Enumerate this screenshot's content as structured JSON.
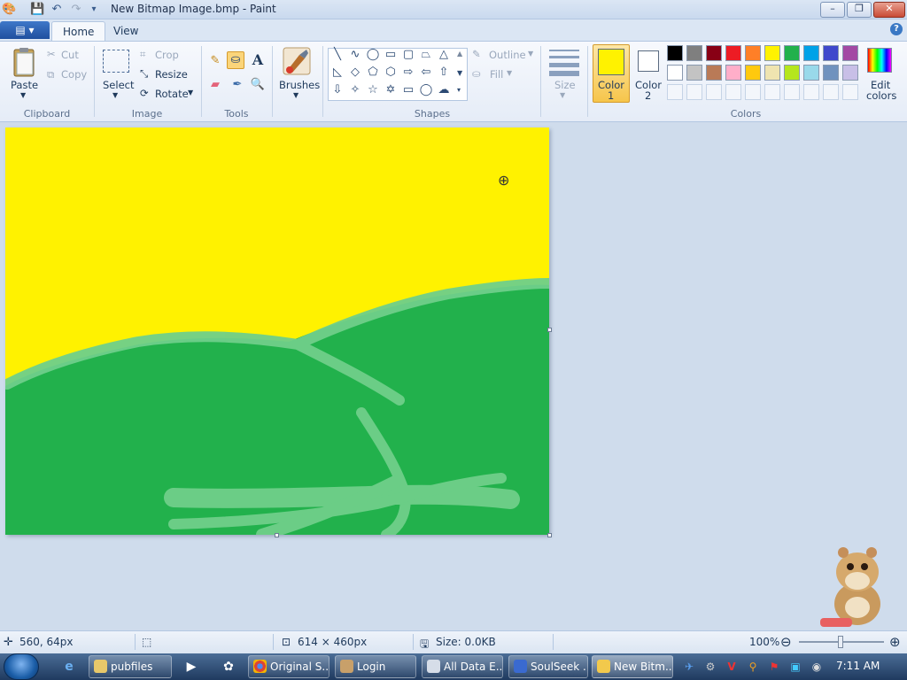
{
  "window": {
    "title": "New Bitmap Image.bmp - Paint",
    "controls": {
      "minimize": "–",
      "maximize": "❐",
      "close": "✕"
    }
  },
  "tabs": {
    "menu": "▤ ▾",
    "home": "Home",
    "view": "View",
    "help": "?"
  },
  "ribbon": {
    "clipboard": {
      "paste": "Paste",
      "cut": "Cut",
      "copy": "Copy",
      "group": "Clipboard"
    },
    "image": {
      "select": "Select",
      "crop": "Crop",
      "resize": "Resize",
      "rotate": "Rotate",
      "group": "Image"
    },
    "tools": {
      "group": "Tools"
    },
    "brushes": {
      "label": "Brushes"
    },
    "shapes": {
      "outline": "Outline",
      "fill": "Fill",
      "group": "Shapes"
    },
    "size": {
      "label": "Size"
    },
    "colors": {
      "color1_label": "Color",
      "color1_num": "1",
      "color2_label": "Color",
      "color2_num": "2",
      "edit_label": "Edit",
      "edit_label2": "colors",
      "group": "Colors",
      "color1_value": "#fff200",
      "color2_value": "#ffffff",
      "palette_row1": [
        "#000000",
        "#7f7f7f",
        "#880015",
        "#ed1c24",
        "#ff7f27",
        "#fff200",
        "#22b14c",
        "#00a2e8",
        "#3f48cc",
        "#a349a4"
      ],
      "palette_row2": [
        "#ffffff",
        "#c3c3c3",
        "#b97a57",
        "#ffaec9",
        "#ffc90e",
        "#efe4b0",
        "#b5e61d",
        "#99d9ea",
        "#7092be",
        "#c8bfe7"
      ]
    }
  },
  "canvas": {
    "sky_color": "#fff200",
    "grass_color": "#22b14c"
  },
  "status": {
    "cursor_pos": "560, 64px",
    "canvas_size": "614 × 460px",
    "file_size": "Size: 0.0KB",
    "zoom": "100%"
  },
  "taskbar": {
    "items": [
      {
        "label": "pubfiles"
      },
      {
        "label": "Original S..."
      },
      {
        "label": "Login"
      },
      {
        "label": "All Data E..."
      },
      {
        "label": "SoulSeek ..."
      },
      {
        "label": "New Bitm..."
      }
    ],
    "clock": "7:11 AM"
  }
}
